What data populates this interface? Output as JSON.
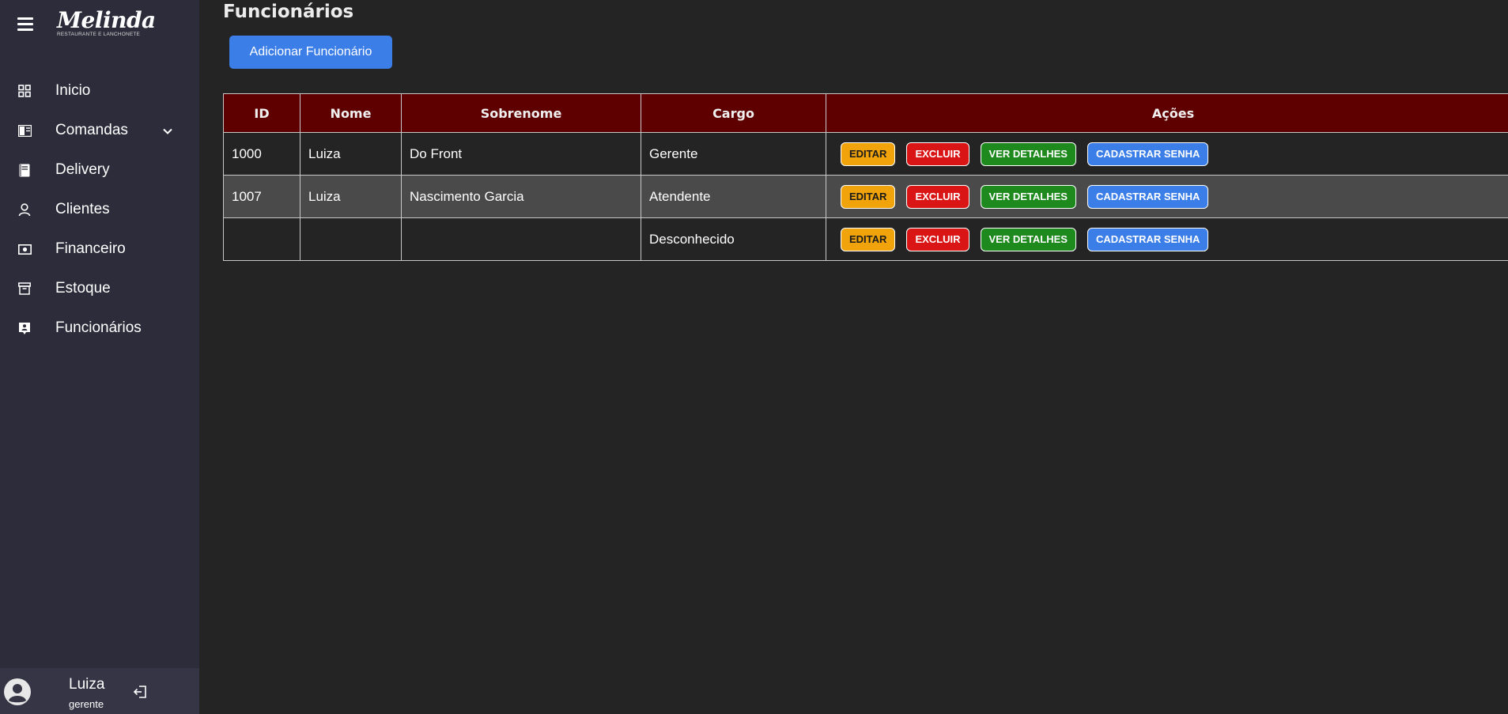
{
  "sidebar": {
    "logo": {
      "title": "Melinda",
      "subtitle": "RESTAURANTE E LANCHONETE"
    },
    "items": [
      {
        "label": "Inicio",
        "icon": "grid-icon"
      },
      {
        "label": "Comandas",
        "icon": "order-book-icon"
      },
      {
        "label": "Delivery",
        "icon": "notebook-icon"
      },
      {
        "label": "Clientes",
        "icon": "person-icon"
      },
      {
        "label": "Financeiro",
        "icon": "cash-icon"
      },
      {
        "label": "Estoque",
        "icon": "archive-box-icon"
      },
      {
        "label": "Funcionários",
        "icon": "employee-badge-icon"
      }
    ],
    "user": {
      "name": "Luiza",
      "role": "gerente"
    }
  },
  "main": {
    "title": "Funcionários",
    "add_button": "Adicionar Funcionário",
    "table": {
      "headers": [
        "ID",
        "Nome",
        "Sobrenome",
        "Cargo",
        "Ações"
      ],
      "rows": [
        {
          "id": "1000",
          "nome": "Luiza",
          "sobrenome": "Do Front",
          "cargo": "Gerente"
        },
        {
          "id": "1007",
          "nome": "Luiza",
          "sobrenome": "Nascimento Garcia",
          "cargo": "Atendente"
        },
        {
          "id": "",
          "nome": "",
          "sobrenome": "",
          "cargo": "Desconhecido"
        }
      ],
      "actions": {
        "edit": "EDITAR",
        "delete": "EXCLUIR",
        "details": "VER DETALHES",
        "password": "CADASTRAR SENHA"
      }
    }
  },
  "colors": {
    "sidebar_bg": "#2c2c3a",
    "main_bg": "#242424",
    "table_header": "#5f0000",
    "primary": "#3b7ee8",
    "edit": "#f0a30a",
    "delete": "#d91515",
    "details": "#1e8a1e"
  }
}
